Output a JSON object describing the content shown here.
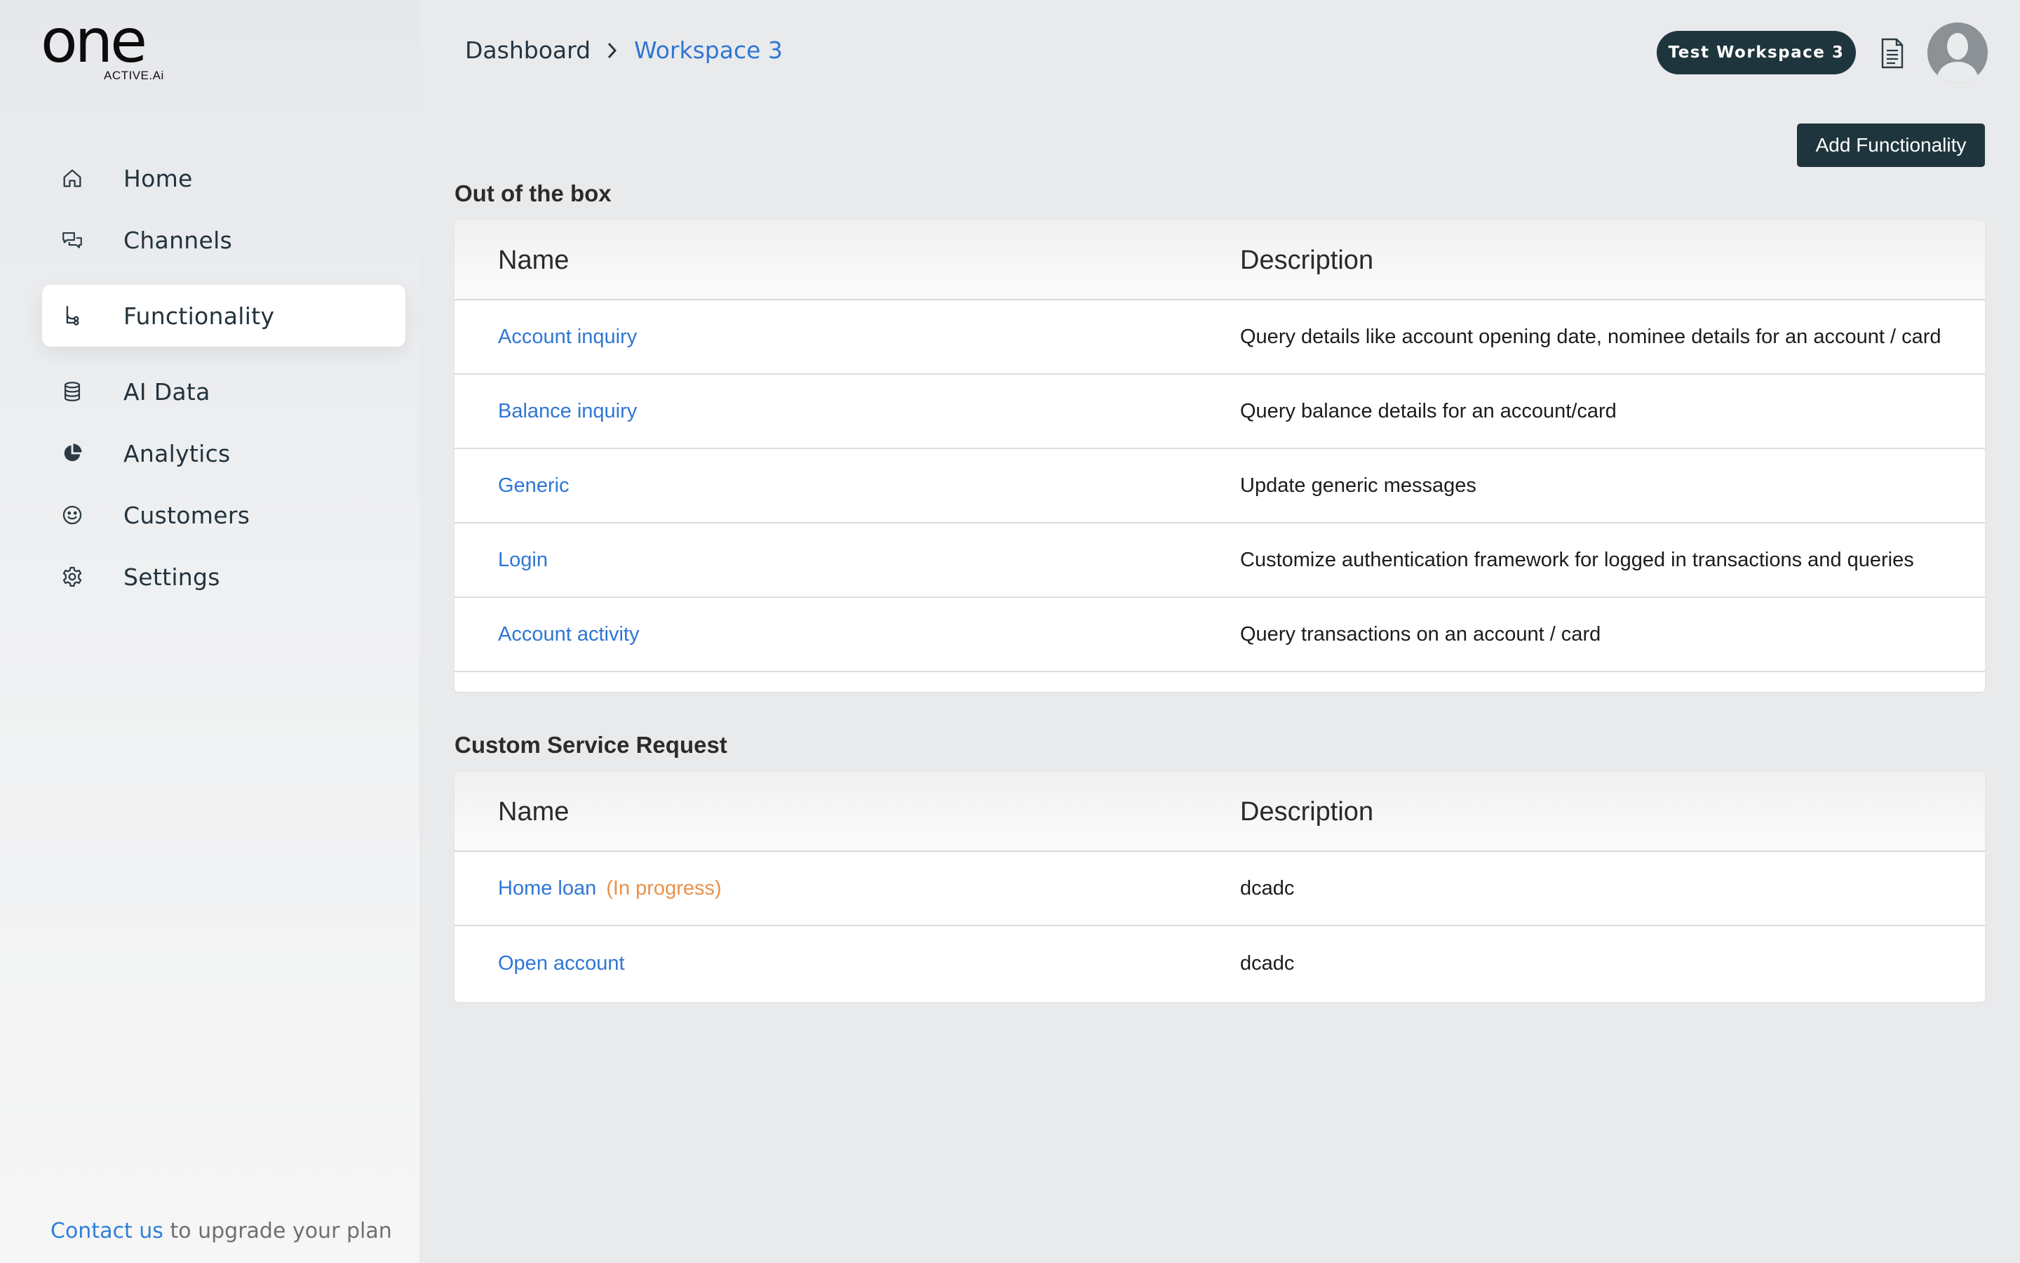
{
  "brand": {
    "word": "one",
    "sub": "ACTIVE.Ai"
  },
  "sidebar": {
    "items": [
      {
        "label": "Home",
        "icon": "home-icon"
      },
      {
        "label": "Channels",
        "icon": "chat-icon"
      },
      {
        "label": "Functionality",
        "icon": "flow-icon",
        "active": true
      },
      {
        "label": "AI Data",
        "icon": "database-icon"
      },
      {
        "label": "Analytics",
        "icon": "pie-chart-icon"
      },
      {
        "label": "Customers",
        "icon": "smiley-icon"
      },
      {
        "label": "Settings",
        "icon": "gear-icon"
      }
    ],
    "upgrade_link": "Contact us",
    "upgrade_text": " to upgrade your plan"
  },
  "header": {
    "breadcrumb_root": "Dashboard",
    "breadcrumb_current": "Workspace 3",
    "workspace_pill": "Test Workspace 3"
  },
  "actions": {
    "add_functionality": "Add Functionality"
  },
  "sections": {
    "out_of_box": {
      "title": "Out of the box",
      "col_name": "Name",
      "col_desc": "Description",
      "rows": [
        {
          "name": "Account inquiry",
          "desc": "Query details like account opening date, nominee details for an account / card"
        },
        {
          "name": "Balance inquiry",
          "desc": "Query balance details for an account/card"
        },
        {
          "name": "Generic",
          "desc": "Update generic messages"
        },
        {
          "name": "Login",
          "desc": "Customize authentication framework for logged in transactions and queries"
        },
        {
          "name": "Account activity",
          "desc": "Query transactions on an account / card"
        }
      ]
    },
    "custom": {
      "title": "Custom Service Request",
      "col_name": "Name",
      "col_desc": "Description",
      "rows": [
        {
          "name": "Home loan",
          "status": "(In progress)",
          "desc": "dcadc"
        },
        {
          "name": "Open account",
          "desc": "dcadc"
        }
      ]
    }
  },
  "colors": {
    "accent": "#2f76d4",
    "dark": "#1f353d",
    "status_in_progress": "#e8924a"
  }
}
